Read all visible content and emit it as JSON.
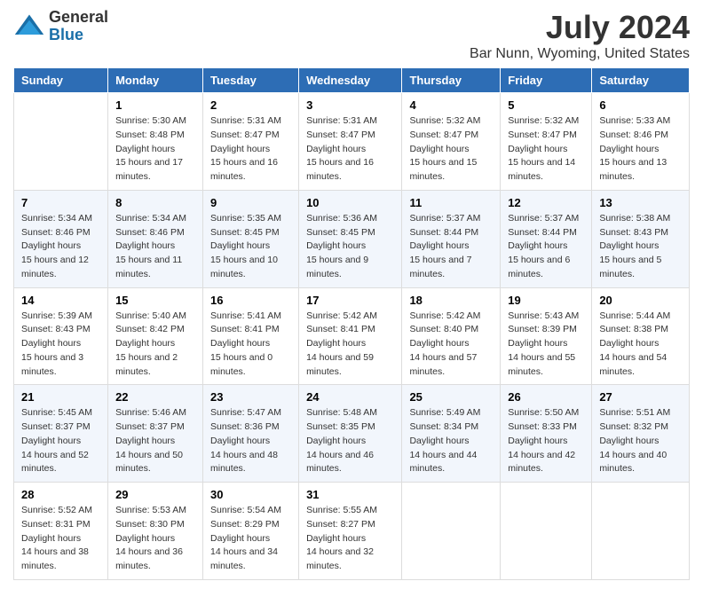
{
  "logo": {
    "general": "General",
    "blue": "Blue"
  },
  "title": "July 2024",
  "subtitle": "Bar Nunn, Wyoming, United States",
  "days_of_week": [
    "Sunday",
    "Monday",
    "Tuesday",
    "Wednesday",
    "Thursday",
    "Friday",
    "Saturday"
  ],
  "weeks": [
    [
      {
        "day": "",
        "sunrise": "",
        "sunset": "",
        "daylight": ""
      },
      {
        "day": "1",
        "sunrise": "5:30 AM",
        "sunset": "8:48 PM",
        "daylight": "15 hours and 17 minutes."
      },
      {
        "day": "2",
        "sunrise": "5:31 AM",
        "sunset": "8:47 PM",
        "daylight": "15 hours and 16 minutes."
      },
      {
        "day": "3",
        "sunrise": "5:31 AM",
        "sunset": "8:47 PM",
        "daylight": "15 hours and 16 minutes."
      },
      {
        "day": "4",
        "sunrise": "5:32 AM",
        "sunset": "8:47 PM",
        "daylight": "15 hours and 15 minutes."
      },
      {
        "day": "5",
        "sunrise": "5:32 AM",
        "sunset": "8:47 PM",
        "daylight": "15 hours and 14 minutes."
      },
      {
        "day": "6",
        "sunrise": "5:33 AM",
        "sunset": "8:46 PM",
        "daylight": "15 hours and 13 minutes."
      }
    ],
    [
      {
        "day": "7",
        "sunrise": "5:34 AM",
        "sunset": "8:46 PM",
        "daylight": "15 hours and 12 minutes."
      },
      {
        "day": "8",
        "sunrise": "5:34 AM",
        "sunset": "8:46 PM",
        "daylight": "15 hours and 11 minutes."
      },
      {
        "day": "9",
        "sunrise": "5:35 AM",
        "sunset": "8:45 PM",
        "daylight": "15 hours and 10 minutes."
      },
      {
        "day": "10",
        "sunrise": "5:36 AM",
        "sunset": "8:45 PM",
        "daylight": "15 hours and 9 minutes."
      },
      {
        "day": "11",
        "sunrise": "5:37 AM",
        "sunset": "8:44 PM",
        "daylight": "15 hours and 7 minutes."
      },
      {
        "day": "12",
        "sunrise": "5:37 AM",
        "sunset": "8:44 PM",
        "daylight": "15 hours and 6 minutes."
      },
      {
        "day": "13",
        "sunrise": "5:38 AM",
        "sunset": "8:43 PM",
        "daylight": "15 hours and 5 minutes."
      }
    ],
    [
      {
        "day": "14",
        "sunrise": "5:39 AM",
        "sunset": "8:43 PM",
        "daylight": "15 hours and 3 minutes."
      },
      {
        "day": "15",
        "sunrise": "5:40 AM",
        "sunset": "8:42 PM",
        "daylight": "15 hours and 2 minutes."
      },
      {
        "day": "16",
        "sunrise": "5:41 AM",
        "sunset": "8:41 PM",
        "daylight": "15 hours and 0 minutes."
      },
      {
        "day": "17",
        "sunrise": "5:42 AM",
        "sunset": "8:41 PM",
        "daylight": "14 hours and 59 minutes."
      },
      {
        "day": "18",
        "sunrise": "5:42 AM",
        "sunset": "8:40 PM",
        "daylight": "14 hours and 57 minutes."
      },
      {
        "day": "19",
        "sunrise": "5:43 AM",
        "sunset": "8:39 PM",
        "daylight": "14 hours and 55 minutes."
      },
      {
        "day": "20",
        "sunrise": "5:44 AM",
        "sunset": "8:38 PM",
        "daylight": "14 hours and 54 minutes."
      }
    ],
    [
      {
        "day": "21",
        "sunrise": "5:45 AM",
        "sunset": "8:37 PM",
        "daylight": "14 hours and 52 minutes."
      },
      {
        "day": "22",
        "sunrise": "5:46 AM",
        "sunset": "8:37 PM",
        "daylight": "14 hours and 50 minutes."
      },
      {
        "day": "23",
        "sunrise": "5:47 AM",
        "sunset": "8:36 PM",
        "daylight": "14 hours and 48 minutes."
      },
      {
        "day": "24",
        "sunrise": "5:48 AM",
        "sunset": "8:35 PM",
        "daylight": "14 hours and 46 minutes."
      },
      {
        "day": "25",
        "sunrise": "5:49 AM",
        "sunset": "8:34 PM",
        "daylight": "14 hours and 44 minutes."
      },
      {
        "day": "26",
        "sunrise": "5:50 AM",
        "sunset": "8:33 PM",
        "daylight": "14 hours and 42 minutes."
      },
      {
        "day": "27",
        "sunrise": "5:51 AM",
        "sunset": "8:32 PM",
        "daylight": "14 hours and 40 minutes."
      }
    ],
    [
      {
        "day": "28",
        "sunrise": "5:52 AM",
        "sunset": "8:31 PM",
        "daylight": "14 hours and 38 minutes."
      },
      {
        "day": "29",
        "sunrise": "5:53 AM",
        "sunset": "8:30 PM",
        "daylight": "14 hours and 36 minutes."
      },
      {
        "day": "30",
        "sunrise": "5:54 AM",
        "sunset": "8:29 PM",
        "daylight": "14 hours and 34 minutes."
      },
      {
        "day": "31",
        "sunrise": "5:55 AM",
        "sunset": "8:27 PM",
        "daylight": "14 hours and 32 minutes."
      },
      {
        "day": "",
        "sunrise": "",
        "sunset": "",
        "daylight": ""
      },
      {
        "day": "",
        "sunrise": "",
        "sunset": "",
        "daylight": ""
      },
      {
        "day": "",
        "sunrise": "",
        "sunset": "",
        "daylight": ""
      }
    ]
  ],
  "labels": {
    "sunrise": "Sunrise:",
    "sunset": "Sunset:",
    "daylight": "Daylight hours"
  }
}
